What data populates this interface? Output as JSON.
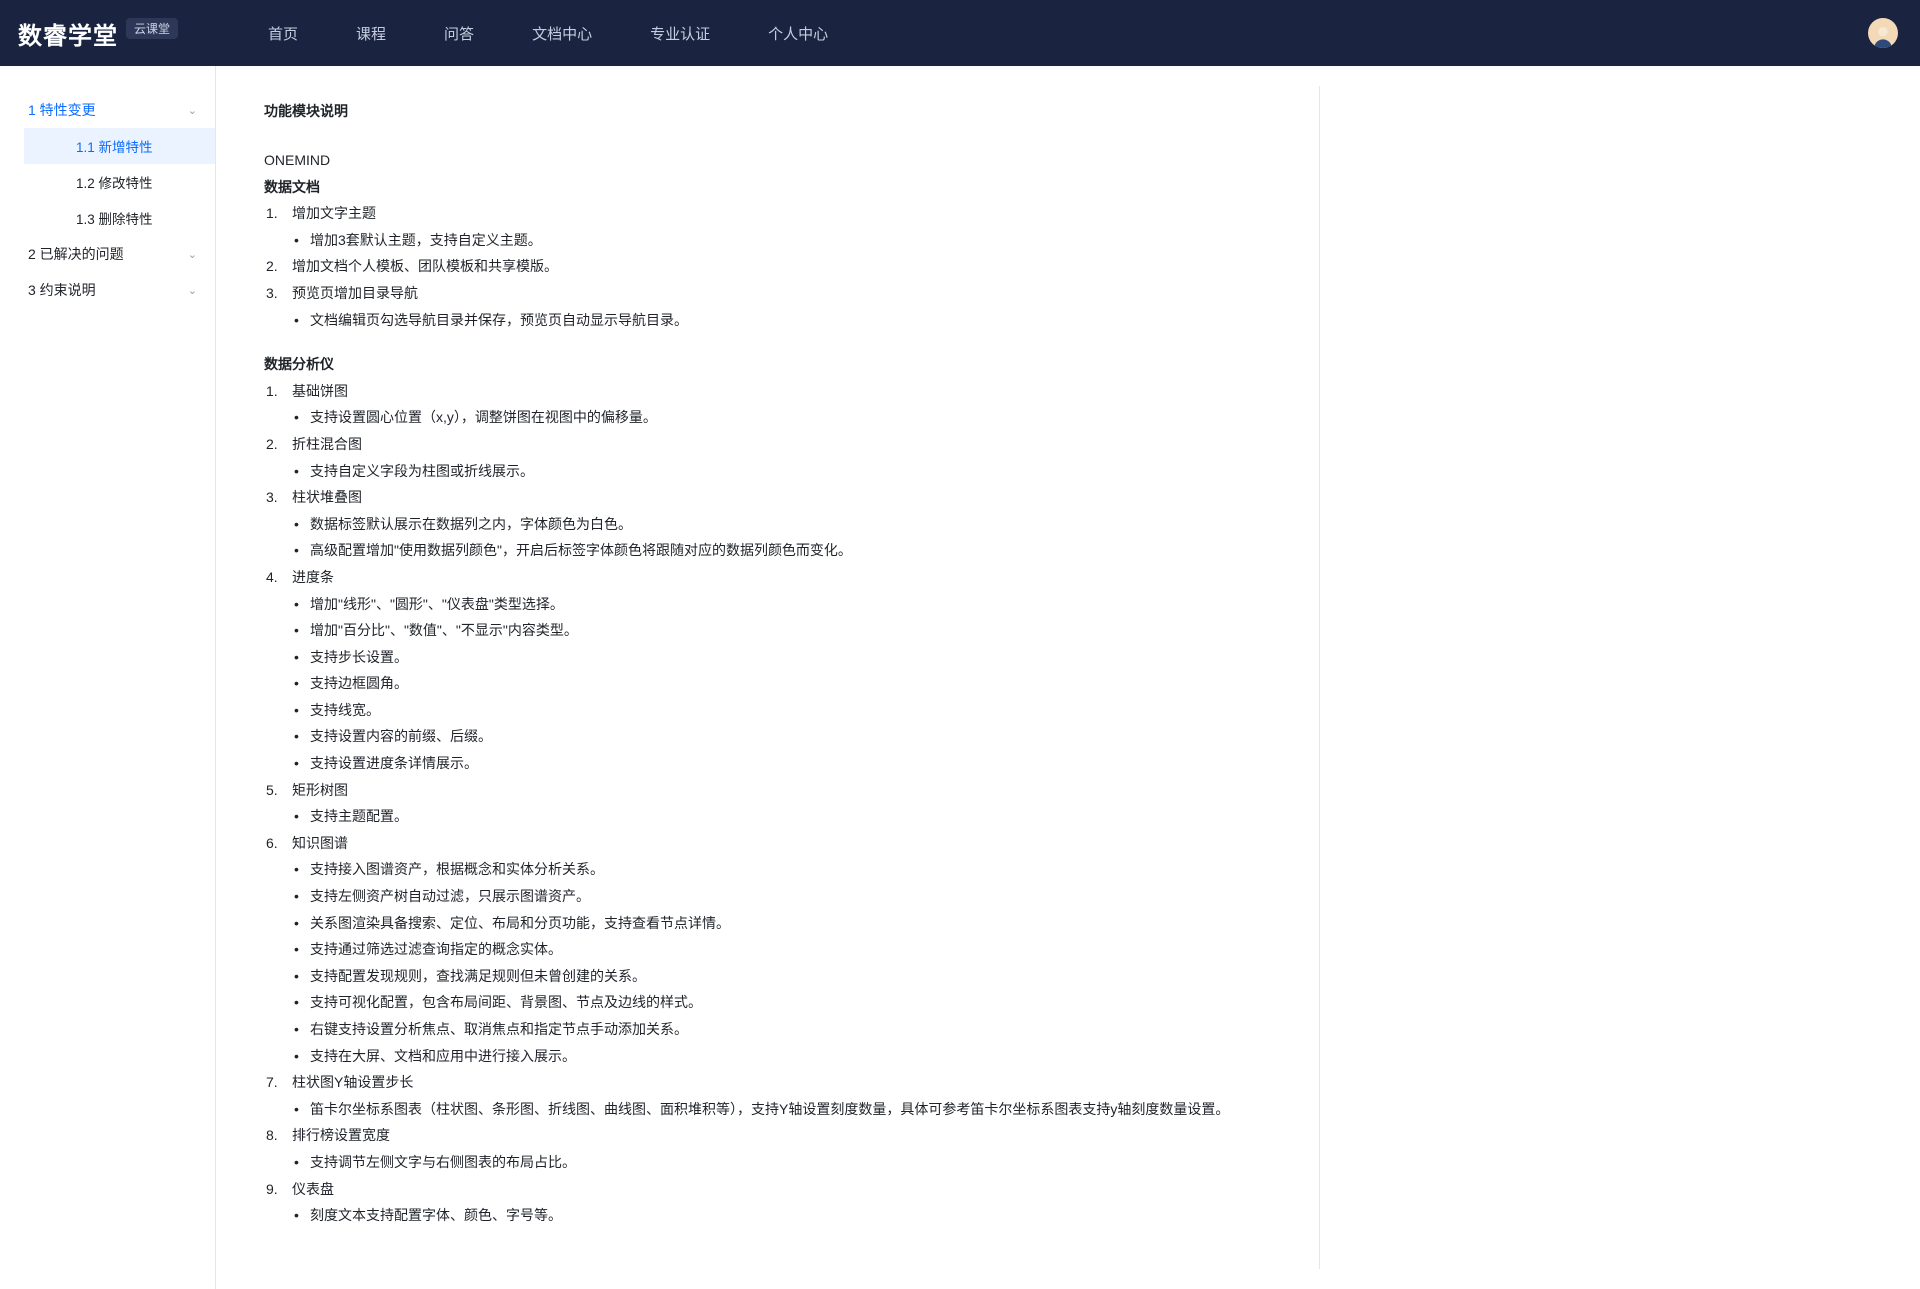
{
  "header": {
    "logo": "数睿学堂",
    "logo_tag": "云课堂",
    "nav": [
      "首页",
      "课程",
      "问答",
      "文档中心",
      "专业认证",
      "个人中心"
    ]
  },
  "sidebar": {
    "items": [
      {
        "label": "1 特性变更",
        "active": true,
        "children": [
          {
            "label": "1.1 新增特性",
            "active": true
          },
          {
            "label": "1.2 修改特性",
            "active": false
          },
          {
            "label": "1.3 删除特性",
            "active": false
          }
        ]
      },
      {
        "label": "2 已解决的问题",
        "active": false
      },
      {
        "label": "3 约束说明",
        "active": false
      }
    ]
  },
  "content": {
    "title": "功能模块说明",
    "line_onemind": "ONEMIND",
    "section1_title": "数据文档",
    "section1": {
      "li1": "增加文字主题",
      "li1_sub1": "增加3套默认主题，支持自定义主题。",
      "li2": "增加文档个人模板、团队模板和共享模版。",
      "li3": "预览页增加目录导航",
      "li3_sub1": "文档编辑页勾选导航目录并保存，预览页自动显示导航目录。"
    },
    "section2_title": "数据分析仪",
    "section2": {
      "li1": "基础饼图",
      "li1_sub1": "支持设置圆心位置（x,y），调整饼图在视图中的偏移量。",
      "li2": "折柱混合图",
      "li2_sub1": "支持自定义字段为柱图或折线展示。",
      "li3": "柱状堆叠图",
      "li3_sub1": "数据标签默认展示在数据列之内，字体颜色为白色。",
      "li3_sub2": "高级配置增加\"使用数据列颜色\"，开启后标签字体颜色将跟随对应的数据列颜色而变化。",
      "li4": "进度条",
      "li4_sub1": "增加\"线形\"、\"圆形\"、\"仪表盘\"类型选择。",
      "li4_sub2": "增加\"百分比\"、\"数值\"、\"不显示\"内容类型。",
      "li4_sub3": "支持步长设置。",
      "li4_sub4": "支持边框圆角。",
      "li4_sub5": "支持线宽。",
      "li4_sub6": "支持设置内容的前缀、后缀。",
      "li4_sub7": "支持设置进度条详情展示。",
      "li5": "矩形树图",
      "li5_sub1": "支持主题配置。",
      "li6": "知识图谱",
      "li6_sub1": "支持接入图谱资产，根据概念和实体分析关系。",
      "li6_sub2": "支持左侧资产树自动过滤，只展示图谱资产。",
      "li6_sub3": "关系图渲染具备搜索、定位、布局和分页功能，支持查看节点详情。",
      "li6_sub4": "支持通过筛选过滤查询指定的概念实体。",
      "li6_sub5": "支持配置发现规则，查找满足规则但未曾创建的关系。",
      "li6_sub6": "支持可视化配置，包含布局间距、背景图、节点及边线的样式。",
      "li6_sub7": "右键支持设置分析焦点、取消焦点和指定节点手动添加关系。",
      "li6_sub8": "支持在大屏、文档和应用中进行接入展示。",
      "li7": "柱状图Y轴设置步长",
      "li7_sub1": "笛卡尔坐标系图表（柱状图、条形图、折线图、曲线图、面积堆积等），支持Y轴设置刻度数量，具体可参考笛卡尔坐标系图表支持y轴刻度数量设置。",
      "li8": "排行榜设置宽度",
      "li8_sub1": "支持调节左侧文字与右侧图表的布局占比。",
      "li9": "仪表盘",
      "li9_sub1": "刻度文本支持配置字体、颜色、字号等。"
    }
  }
}
